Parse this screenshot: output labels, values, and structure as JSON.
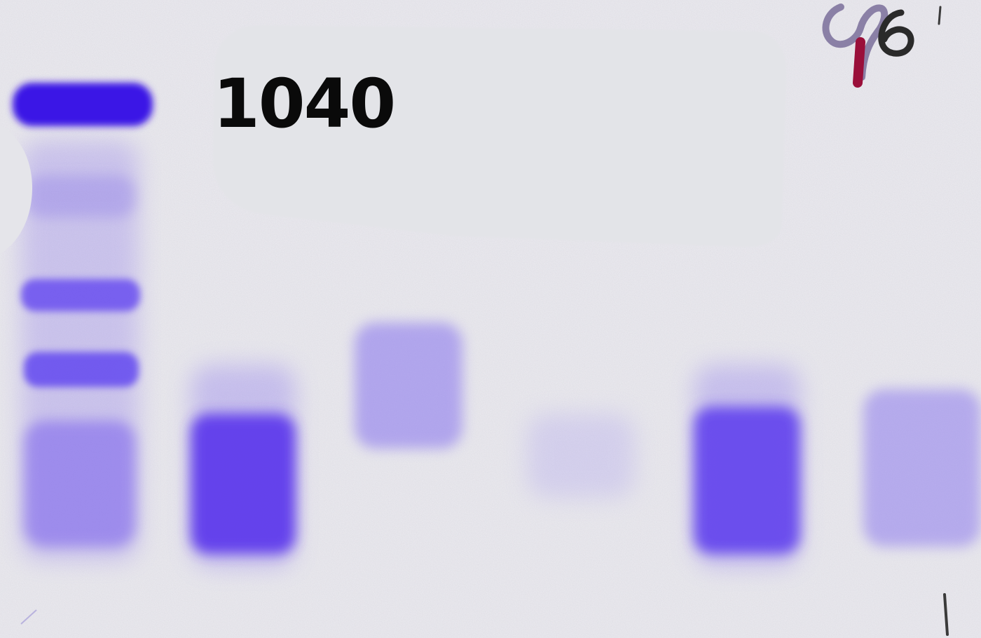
{
  "label": {
    "text": "1040"
  },
  "colors": {
    "paper": "#ecebf0",
    "dye": "#5b3bea",
    "sticker": "#e3e4e8",
    "pen_mark": "#2a2a2a",
    "ink_red": "#9a0f3a",
    "ink_purple": "#7a6e9a"
  },
  "lanes": [
    {
      "name": "lane-1-ladder",
      "bands": [
        {
          "level": 0.95,
          "kind": "sharp"
        },
        {
          "level": 0.2,
          "kind": "diffuse"
        },
        {
          "level": 0.75,
          "kind": "sharp"
        },
        {
          "level": 0.75,
          "kind": "sharp"
        },
        {
          "level": 0.45,
          "kind": "diffuse"
        }
      ]
    },
    {
      "name": "lane-2",
      "bands": [
        {
          "level": 0.85,
          "kind": "diffuse"
        }
      ]
    },
    {
      "name": "lane-3",
      "bands": [
        {
          "level": 0.4,
          "kind": "diffuse"
        }
      ]
    },
    {
      "name": "lane-4",
      "bands": [
        {
          "level": 0.12,
          "kind": "diffuse"
        }
      ]
    },
    {
      "name": "lane-5",
      "bands": [
        {
          "level": 0.8,
          "kind": "diffuse"
        }
      ]
    },
    {
      "name": "lane-6",
      "bands": [
        {
          "level": 0.45,
          "kind": "diffuse"
        }
      ]
    }
  ]
}
